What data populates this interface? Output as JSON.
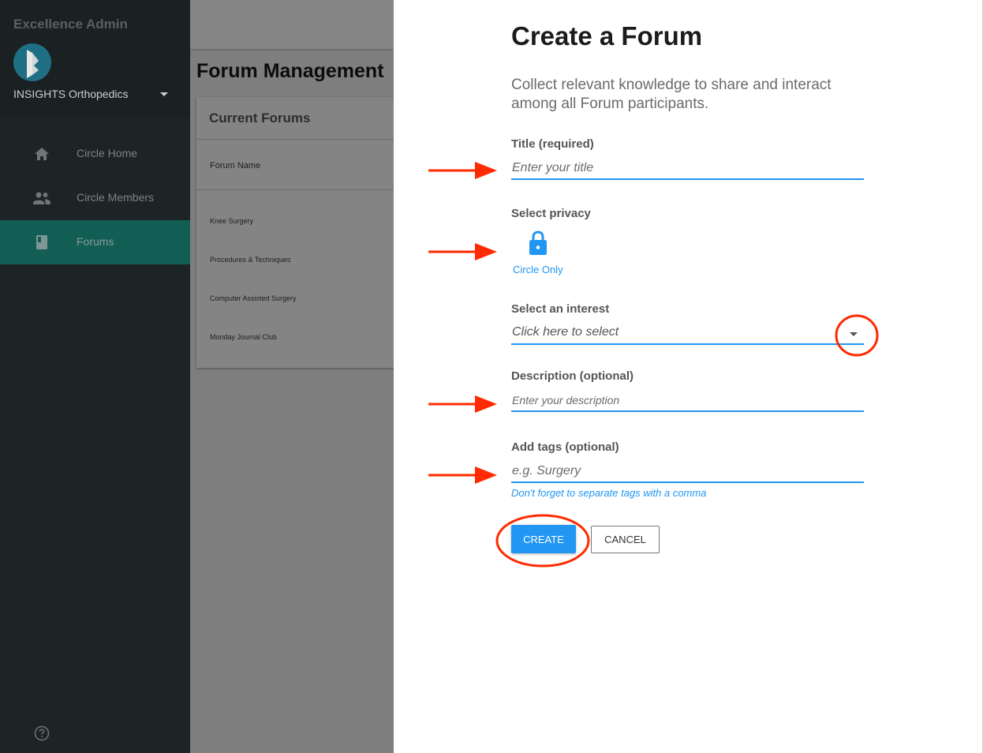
{
  "sidebar": {
    "app_title": "Excellence Admin",
    "org_name": "INSIGHTS Orthopedics",
    "items": [
      {
        "label": "Circle Home",
        "icon": "home-icon"
      },
      {
        "label": "Circle Members",
        "icon": "people-icon"
      },
      {
        "label": "Forums",
        "icon": "book-icon",
        "active": true
      }
    ],
    "help_icon": "help-circle-icon"
  },
  "background_page": {
    "title": "Forum Management",
    "card_title": "Current Forums",
    "column_header": "Forum Name",
    "forums": [
      "Knee Surgery",
      "Procedures & Techniques",
      "Computer Assisted Surgery",
      "Monday Journal Club"
    ]
  },
  "form": {
    "title": "Create a Forum",
    "subtitle": "Collect relevant knowledge to share and interact among all Forum participants.",
    "title_label": "Title (required)",
    "title_placeholder": "Enter your title",
    "privacy_label": "Select privacy",
    "privacy_option": "Circle Only",
    "interest_label": "Select an interest",
    "interest_placeholder": "Click here to select",
    "description_label": "Description (optional)",
    "description_placeholder": "Enter your description",
    "tags_label": "Add tags (optional)",
    "tags_placeholder": "e.g. Surgery",
    "tags_hint": "Don't forget to separate tags with a comma",
    "create_label": "CREATE",
    "cancel_label": "CANCEL"
  },
  "colors": {
    "accent": "#2196f3",
    "sidebar_bg": "#1d2425",
    "sidebar_active": "#125e55",
    "annotation": "#ff2a00"
  }
}
